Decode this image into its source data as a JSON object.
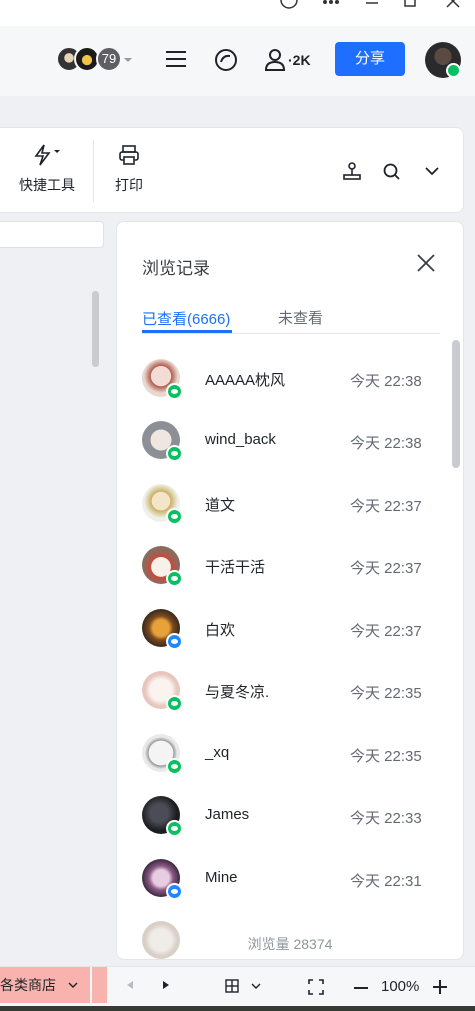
{
  "header": {
    "collaborator_count": "79",
    "user_count": "·2K",
    "share_label": "分享"
  },
  "toolbar": {
    "quick_tools_label": "快捷工具",
    "print_label": "打印"
  },
  "panel": {
    "title": "浏览记录",
    "tab_viewed": "已查看(6666)",
    "tab_unviewed": "未查看",
    "rows": [
      {
        "name": "AAAAA枕风",
        "time": "今天 22:38",
        "badge": "wechat"
      },
      {
        "name": "wind_back",
        "time": "今天 22:38",
        "badge": "wechat"
      },
      {
        "name": "道文",
        "time": "今天 22:37",
        "badge": "wechat"
      },
      {
        "name": "干活干活",
        "time": "今天 22:37",
        "badge": "wechat"
      },
      {
        "name": "白欢",
        "time": "今天 22:37",
        "badge": "qq"
      },
      {
        "name": "与夏冬凉.",
        "time": "今天 22:35",
        "badge": "wechat"
      },
      {
        "name": "_xq",
        "time": "今天 22:35",
        "badge": "wechat"
      },
      {
        "name": "James",
        "time": "今天 22:33",
        "badge": "wechat"
      },
      {
        "name": "Mine",
        "time": "今天 22:31",
        "badge": "qq"
      }
    ],
    "footer": "浏览量 28374"
  },
  "bottom": {
    "sheet_tab": "各类商店",
    "zoom": "100%"
  },
  "colors": {
    "accent": "#1e6fff",
    "wechat": "#07c160",
    "qq": "#1e88ff"
  }
}
